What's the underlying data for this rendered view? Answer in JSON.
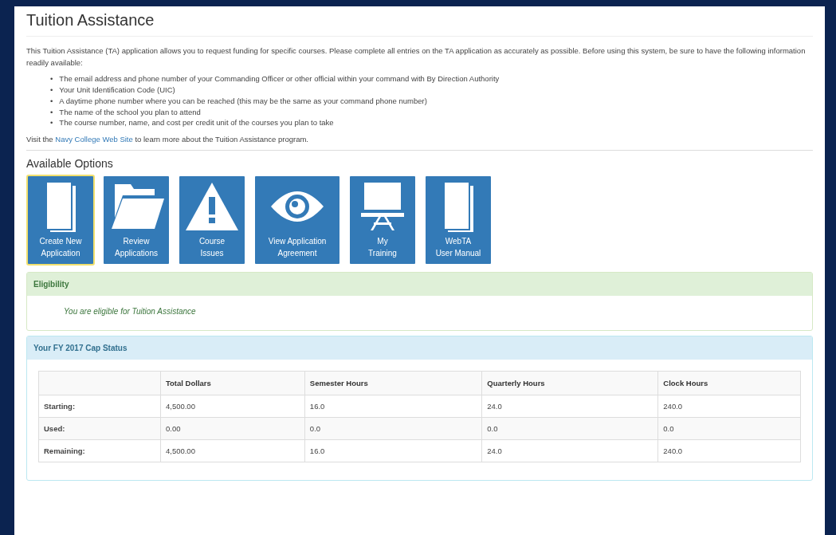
{
  "title": "Tuition Assistance",
  "intro": "This Tuition Assistance (TA) application allows you to request funding for specific courses. Please complete all entries on the TA application as accurately as possible. Before using this system, be sure to have the following information readily available:",
  "requirements": [
    {
      "bullet": "•",
      "text": "The email address and phone number of your Commanding Officer or other official within your command with By Direction Authority"
    },
    {
      "bullet": "•",
      "text": "Your Unit Identification Code (UIC)"
    },
    {
      "bullet": "•",
      "text": "A daytime phone number where you can be reached (this may be the same as your command phone number)"
    },
    {
      "bullet": "•",
      "text": "The name of the school you plan to attend"
    },
    {
      "bullet": "•",
      "text": "The course number, name, and cost per credit unit of the courses you plan to take"
    }
  ],
  "visit": {
    "before": "Visit the",
    "link": "Navy College Web Site",
    "after": "to learn more about the Tuition Assistance program."
  },
  "options_heading": "Available Options",
  "options": [
    {
      "kind": "document",
      "lines": [
        "Create New",
        "Application"
      ],
      "selected": true
    },
    {
      "kind": "folder",
      "lines": [
        "Review",
        "Applications"
      ],
      "selected": false
    },
    {
      "kind": "warning",
      "lines": [
        "Course",
        "Issues"
      ],
      "selected": false
    },
    {
      "kind": "eye",
      "lines": [
        "View Application",
        "Agreement"
      ],
      "selected": false
    },
    {
      "kind": "easel",
      "lines": [
        "My",
        "Training"
      ],
      "selected": false
    },
    {
      "kind": "book",
      "lines": [
        "WebTA",
        "User Manual"
      ],
      "selected": false
    }
  ],
  "eligibility": {
    "heading": "Eligibility",
    "message": "You are eligible for Tuition Assistance"
  },
  "cap_status": {
    "heading": "Your FY 2017 Cap Status",
    "columns": [
      "Total Dollars",
      "Semester Hours",
      "Quarterly Hours",
      "Clock Hours"
    ],
    "rows": [
      {
        "label": "Starting:",
        "cells": [
          "4,500.00",
          "16.0",
          "24.0",
          "240.0"
        ]
      },
      {
        "label": "Used:",
        "cells": [
          "0.00",
          "0.0",
          "0.0",
          "0.0"
        ]
      },
      {
        "label": "Remaining:",
        "cells": [
          "4,500.00",
          "16.0",
          "24.0",
          "240.0"
        ]
      }
    ]
  }
}
